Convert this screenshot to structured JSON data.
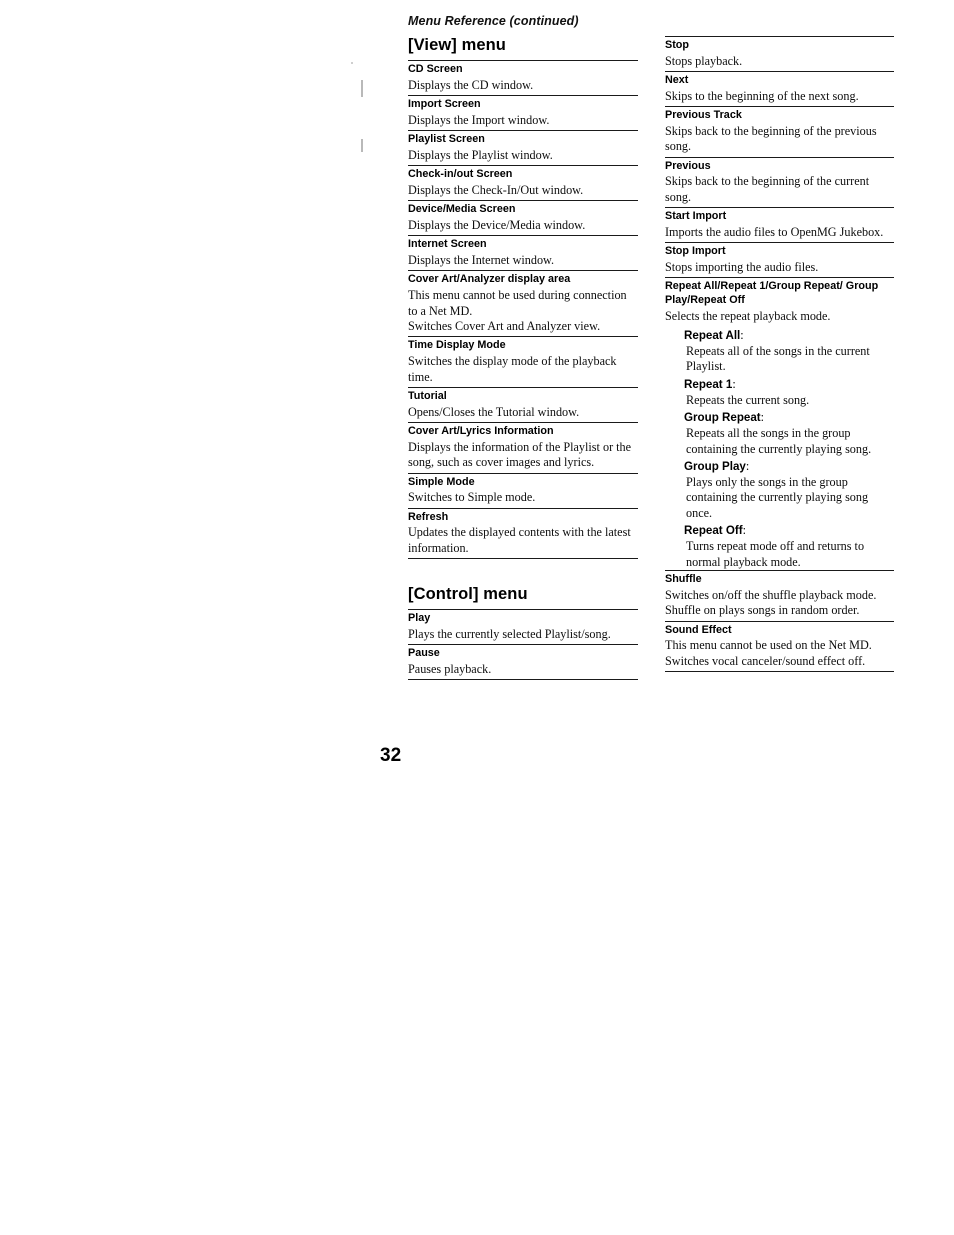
{
  "page": {
    "running_head": "Menu Reference (continued)",
    "folio": "32"
  },
  "left_column": {
    "sections": [
      {
        "title": "[View] menu",
        "entries": [
          {
            "term": "CD Screen",
            "desc": [
              "Displays the CD window."
            ]
          },
          {
            "term": "Import Screen",
            "desc": [
              "Displays the Import window."
            ]
          },
          {
            "term": "Playlist Screen",
            "desc": [
              "Displays the Playlist window."
            ]
          },
          {
            "term": "Check-in/out Screen",
            "desc": [
              "Displays the Check-In/Out window."
            ]
          },
          {
            "term": "Device/Media Screen",
            "desc": [
              "Displays the Device/Media window."
            ]
          },
          {
            "term": "Internet Screen",
            "desc": [
              "Displays the Internet window."
            ]
          },
          {
            "term": "Cover Art/Analyzer display area",
            "desc": [
              "This menu cannot be used during connection to a Net MD.",
              "Switches Cover Art and Analyzer view."
            ]
          },
          {
            "term": "Time Display Mode",
            "desc": [
              "Switches the display mode of the playback time."
            ]
          },
          {
            "term": "Tutorial",
            "desc": [
              "Opens/Closes the Tutorial window."
            ]
          },
          {
            "term": "Cover Art/Lyrics Information",
            "desc": [
              "Displays the information of the Playlist or the song, such as cover images and lyrics."
            ]
          },
          {
            "term": "Simple Mode",
            "desc": [
              "Switches to Simple mode."
            ]
          },
          {
            "term": "Refresh",
            "desc": [
              "Updates the displayed contents with the latest information."
            ]
          }
        ]
      },
      {
        "title": "[Control] menu",
        "entries": [
          {
            "term": "Play",
            "desc": [
              "Plays the currently selected Playlist/song."
            ]
          },
          {
            "term": "Pause",
            "desc": [
              "Pauses playback."
            ]
          }
        ]
      }
    ]
  },
  "right_column": {
    "entries": [
      {
        "term": "Stop",
        "desc": [
          "Stops playback."
        ]
      },
      {
        "term": "Next",
        "desc": [
          "Skips to the beginning of the next song."
        ]
      },
      {
        "term": "Previous Track",
        "desc": [
          "Skips back to the beginning of the previous song."
        ]
      },
      {
        "term": "Previous",
        "desc": [
          "Skips back to the beginning of the current song."
        ]
      },
      {
        "term": "Start Import",
        "desc": [
          "Imports the audio files to OpenMG Jukebox."
        ]
      },
      {
        "term": "Stop Import",
        "desc": [
          "Stops importing the audio files."
        ]
      },
      {
        "term": "Repeat All/Repeat 1/Group Repeat/ Group Play/Repeat Off",
        "desc": [
          "Selects the repeat playback mode."
        ],
        "subentries": [
          {
            "term": "Repeat All",
            "desc": "Repeats all of the songs in the current Playlist."
          },
          {
            "term": "Repeat 1",
            "desc": "Repeats the current song."
          },
          {
            "term": "Group Repeat",
            "desc": "Repeats all the songs in the group containing the currently playing song."
          },
          {
            "term": "Group Play",
            "desc": "Plays only the songs in the group containing the currently playing song once."
          },
          {
            "term": "Repeat Off",
            "desc": "Turns repeat mode off and returns to normal playback mode."
          }
        ]
      },
      {
        "term": "Shuffle",
        "desc": [
          "Switches on/off the shuffle playback mode. Shuffle on plays songs in random order."
        ]
      },
      {
        "term": "Sound Effect",
        "desc": [
          "This menu cannot be used on the Net MD.",
          "Switches vocal canceler/sound effect off."
        ]
      }
    ]
  }
}
